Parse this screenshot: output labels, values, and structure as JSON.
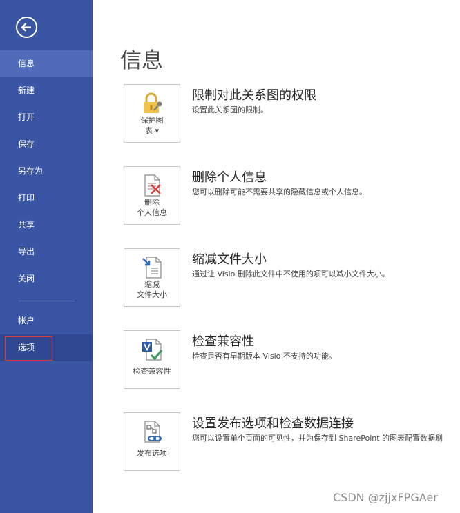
{
  "sidebar": {
    "items": [
      {
        "label": "信息"
      },
      {
        "label": "新建"
      },
      {
        "label": "打开"
      },
      {
        "label": "保存"
      },
      {
        "label": "另存为"
      },
      {
        "label": "打印"
      },
      {
        "label": "共享"
      },
      {
        "label": "导出"
      },
      {
        "label": "关闭"
      },
      {
        "label": "帐户"
      },
      {
        "label": "选项"
      }
    ]
  },
  "page": {
    "title": "信息"
  },
  "sections": [
    {
      "button_label": "保护图\n表 ▾",
      "title": "限制对此关系图的权限",
      "description": "设置此关系图的限制。",
      "icon": "lock-key-icon"
    },
    {
      "button_label": "删除\n个人信息",
      "title": "删除个人信息",
      "description": "您可以删除可能不需要共享的隐藏信息或个人信息。",
      "icon": "remove-info-icon"
    },
    {
      "button_label": "缩减\n文件大小",
      "title": "缩减文件大小",
      "description": "通过让 Visio 删除此文件中不使用的项可以减小文件大小。",
      "icon": "compress-file-icon"
    },
    {
      "button_label": "检查兼容性",
      "title": "检查兼容性",
      "description": "检查是否有早期版本 Visio 不支持的功能。",
      "icon": "compatibility-check-icon"
    },
    {
      "button_label": "发布选项",
      "title": "设置发布选项和检查数据连接",
      "description": "您可以设置单个页面的可见性，并为保存到 SharePoint 的图表配置数据刷",
      "icon": "publish-options-icon"
    }
  ],
  "watermark": "CSDN @zjjxFPGAer"
}
